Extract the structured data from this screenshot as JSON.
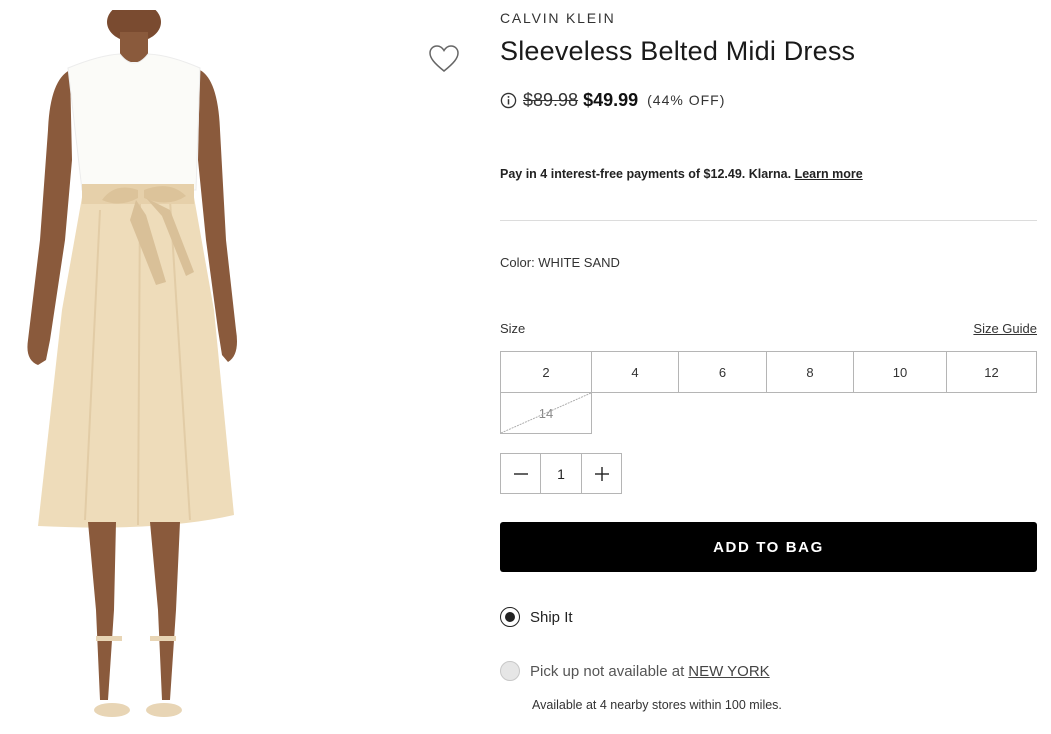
{
  "product": {
    "brand": "CALVIN KLEIN",
    "title": "Sleeveless Belted Midi Dress",
    "original_price": "$89.98",
    "sale_price": "$49.99",
    "discount": "(44% OFF)"
  },
  "klarna": {
    "text": "Pay in 4 interest-free payments of $12.49. Klarna.",
    "link": "Learn more"
  },
  "color": {
    "label": "Color: WHITE SAND"
  },
  "size": {
    "label": "Size",
    "guide_label": "Size Guide",
    "options": [
      {
        "label": "2",
        "available": true
      },
      {
        "label": "4",
        "available": true
      },
      {
        "label": "6",
        "available": true
      },
      {
        "label": "8",
        "available": true
      },
      {
        "label": "10",
        "available": true
      },
      {
        "label": "12",
        "available": true
      },
      {
        "label": "14",
        "available": false
      }
    ]
  },
  "quantity": {
    "value": "1"
  },
  "add_to_bag": {
    "label": "ADD TO BAG"
  },
  "fulfillment": {
    "ship_label": "Ship It",
    "ship_selected": true,
    "pickup_text": "Pick up not available at",
    "pickup_store": "NEW YORK",
    "nearby_text": "Available at 4 nearby stores within 100 miles."
  },
  "icons": [
    "heart-icon",
    "info-icon",
    "minus-icon",
    "plus-icon"
  ],
  "colors": {
    "button_bg": "#000000",
    "dress_top": "#fbfbf8",
    "dress_skirt": "#eedcba",
    "skin": "#8a5a3c"
  }
}
